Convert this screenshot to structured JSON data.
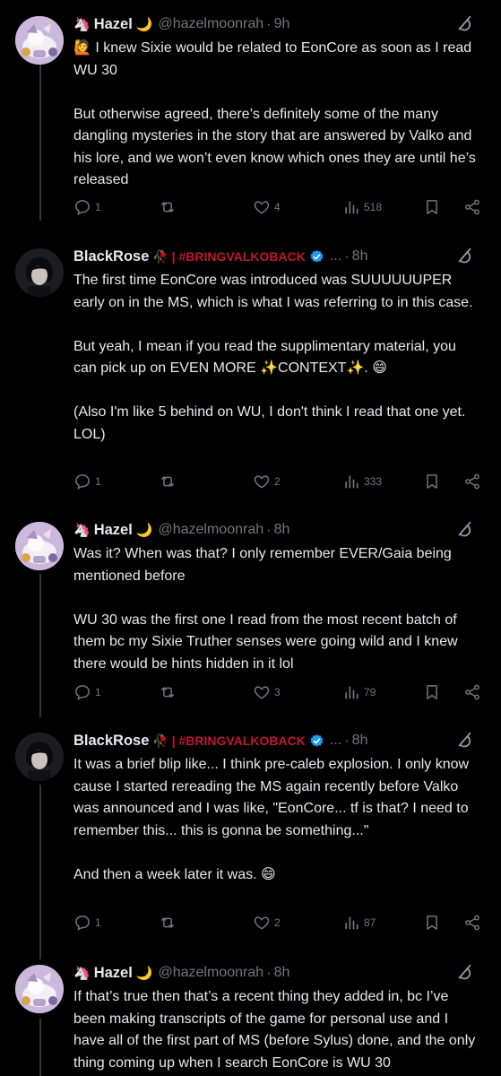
{
  "posts": [
    {
      "author": "Hazel",
      "author_emoji": "🦄",
      "name_suffix": "🌙",
      "handle": "@hazelmoonrah",
      "time": "9h",
      "verified": false,
      "text": "🙋 I knew Sixie would be related to EonCore as soon as I read WU 30\n\nBut otherwise agreed, there’s definitely some of the many dangling mysteries in the story that are answered by Valko and his lore, and we won’t even know which ones they are until he’s released",
      "replies": "1",
      "reposts": "",
      "likes": "4",
      "views": "518"
    },
    {
      "author": "BlackRose",
      "author_emoji": "",
      "name_suffix": "🥀 | #BRINGVALKOBACK",
      "handle": "...",
      "time": "8h",
      "verified": true,
      "text": "The first time EonCore was introduced was SUUUUUUPER early on in the MS, which is what I was referring to in this case.\n\nBut yeah, I mean if you read the supplimentary material, you can pick up on EVEN MORE ✨CONTEXT✨. 😄\n\n(Also I'm like 5 behind on WU, I don't think I read that one yet. LOL)",
      "replies": "1",
      "reposts": "",
      "likes": "2",
      "views": "333"
    },
    {
      "author": "Hazel",
      "author_emoji": "🦄",
      "name_suffix": "🌙",
      "handle": "@hazelmoonrah",
      "time": "8h",
      "verified": false,
      "text": "Was it? When was that? I only remember EVER/Gaia being mentioned before\n\nWU 30 was the first one I read from the most recent batch of them bc my Sixie Truther senses were going wild and I knew there would be hints hidden in it lol",
      "replies": "1",
      "reposts": "",
      "likes": "3",
      "views": "79"
    },
    {
      "author": "BlackRose",
      "author_emoji": "",
      "name_suffix": "🥀 | #BRINGVALKOBACK",
      "handle": "...",
      "time": "8h",
      "verified": true,
      "text": "It was a brief blip like... I think pre-caleb explosion. I only know cause I started rereading the MS again recently before Valko was announced and I was like, \"EonCore... tf is that? I need to remember this... this is gonna be something...\"\n\nAnd then a week later it was. 😄",
      "replies": "1",
      "reposts": "",
      "likes": "2",
      "views": "87"
    },
    {
      "author": "Hazel",
      "author_emoji": "🦄",
      "name_suffix": "🌙",
      "handle": "@hazelmoonrah",
      "time": "8h",
      "verified": false,
      "text": "If that’s true then that’s a recent thing they added in, bc I’ve been making transcripts of the game for personal use and I have all of the first part of MS (before Sylus) done, and the only thing coming up when I search EonCore is WU 30",
      "replies": "",
      "reposts": "",
      "likes": "",
      "views": ""
    }
  ],
  "colors": {
    "background": "#000000",
    "text": "#e7e9ea",
    "muted": "#71767b",
    "verified": "#1d9bf0",
    "thread_line": "#333639"
  },
  "icons": [
    "reply-icon",
    "repost-icon",
    "like-icon",
    "views-icon",
    "bookmark-icon",
    "share-icon",
    "grok-icon",
    "verified-badge-icon"
  ]
}
